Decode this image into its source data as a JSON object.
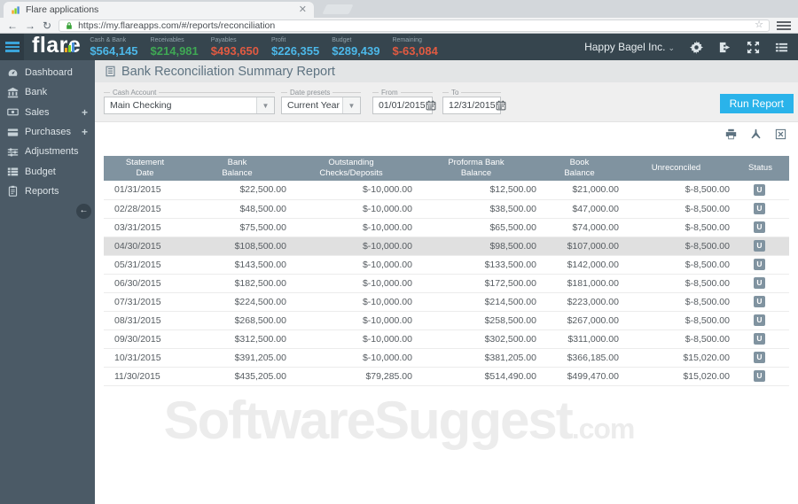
{
  "browser": {
    "tab_title": "Flare applications",
    "url": "https://my.flareapps.com/#/reports/reconciliation"
  },
  "header": {
    "logo_text": "flare",
    "company": "Happy Bagel Inc.",
    "company_caret": "⌄",
    "stats": [
      {
        "label": "Cash & Bank",
        "value": "$564,145",
        "color": "#4cb8e9"
      },
      {
        "label": "Receivables",
        "value": "$214,981",
        "color": "#3fa854"
      },
      {
        "label": "Payables",
        "value": "$493,650",
        "color": "#e25a41"
      },
      {
        "label": "Profit",
        "value": "$226,355",
        "color": "#4cb8e9"
      },
      {
        "label": "Budget",
        "value": "$289,439",
        "color": "#4cb8e9"
      },
      {
        "label": "Remaining",
        "value": "$-63,084",
        "color": "#e25a41"
      }
    ]
  },
  "sidebar": {
    "expand_glyph": "+",
    "items": [
      {
        "label": "Dashboard",
        "icon": "dashboard-icon",
        "expandable": false
      },
      {
        "label": "Bank",
        "icon": "bank-icon",
        "expandable": false
      },
      {
        "label": "Sales",
        "icon": "sales-icon",
        "expandable": true
      },
      {
        "label": "Purchases",
        "icon": "purchases-icon",
        "expandable": true
      },
      {
        "label": "Adjustments",
        "icon": "adjustments-icon",
        "expandable": false
      },
      {
        "label": "Budget",
        "icon": "budget-icon",
        "expandable": false
      },
      {
        "label": "Reports",
        "icon": "reports-icon",
        "expandable": false
      }
    ]
  },
  "report": {
    "title": "Bank Reconciliation Summary Report",
    "filters": {
      "cash_account": {
        "label": "Cash Account",
        "value": "Main Checking"
      },
      "date_presets": {
        "label": "Date presets",
        "value": "Current Year"
      },
      "from": {
        "label": "From",
        "value": "01/01/2015"
      },
      "to": {
        "label": "To",
        "value": "12/31/2015"
      },
      "run_button": "Run Report"
    },
    "table": {
      "columns": [
        [
          "Statement",
          "Date"
        ],
        [
          "Bank",
          "Balance"
        ],
        [
          "Outstanding",
          "Checks/Deposits"
        ],
        [
          "Proforma Bank",
          "Balance"
        ],
        [
          "Book",
          "Balance"
        ],
        [
          "Unreconciled"
        ],
        [
          "Status"
        ]
      ],
      "rows": [
        {
          "date": "01/31/2015",
          "bank_balance": "$22,500.00",
          "outstanding": "$-10,000.00",
          "proforma": "$12,500.00",
          "book": "$21,000.00",
          "unreconciled": "$-8,500.00",
          "status": "U",
          "highlighted": false
        },
        {
          "date": "02/28/2015",
          "bank_balance": "$48,500.00",
          "outstanding": "$-10,000.00",
          "proforma": "$38,500.00",
          "book": "$47,000.00",
          "unreconciled": "$-8,500.00",
          "status": "U",
          "highlighted": false
        },
        {
          "date": "03/31/2015",
          "bank_balance": "$75,500.00",
          "outstanding": "$-10,000.00",
          "proforma": "$65,500.00",
          "book": "$74,000.00",
          "unreconciled": "$-8,500.00",
          "status": "U",
          "highlighted": false
        },
        {
          "date": "04/30/2015",
          "bank_balance": "$108,500.00",
          "outstanding": "$-10,000.00",
          "proforma": "$98,500.00",
          "book": "$107,000.00",
          "unreconciled": "$-8,500.00",
          "status": "U",
          "highlighted": true
        },
        {
          "date": "05/31/2015",
          "bank_balance": "$143,500.00",
          "outstanding": "$-10,000.00",
          "proforma": "$133,500.00",
          "book": "$142,000.00",
          "unreconciled": "$-8,500.00",
          "status": "U",
          "highlighted": false
        },
        {
          "date": "06/30/2015",
          "bank_balance": "$182,500.00",
          "outstanding": "$-10,000.00",
          "proforma": "$172,500.00",
          "book": "$181,000.00",
          "unreconciled": "$-8,500.00",
          "status": "U",
          "highlighted": false
        },
        {
          "date": "07/31/2015",
          "bank_balance": "$224,500.00",
          "outstanding": "$-10,000.00",
          "proforma": "$214,500.00",
          "book": "$223,000.00",
          "unreconciled": "$-8,500.00",
          "status": "U",
          "highlighted": false
        },
        {
          "date": "08/31/2015",
          "bank_balance": "$268,500.00",
          "outstanding": "$-10,000.00",
          "proforma": "$258,500.00",
          "book": "$267,000.00",
          "unreconciled": "$-8,500.00",
          "status": "U",
          "highlighted": false
        },
        {
          "date": "09/30/2015",
          "bank_balance": "$312,500.00",
          "outstanding": "$-10,000.00",
          "proforma": "$302,500.00",
          "book": "$311,000.00",
          "unreconciled": "$-8,500.00",
          "status": "U",
          "highlighted": false
        },
        {
          "date": "10/31/2015",
          "bank_balance": "$391,205.00",
          "outstanding": "$-10,000.00",
          "proforma": "$381,205.00",
          "book": "$366,185.00",
          "unreconciled": "$15,020.00",
          "status": "U",
          "highlighted": false
        },
        {
          "date": "11/30/2015",
          "bank_balance": "$435,205.00",
          "outstanding": "$79,285.00",
          "proforma": "$514,490.00",
          "book": "$499,470.00",
          "unreconciled": "$15,020.00",
          "status": "U",
          "highlighted": false
        }
      ]
    }
  },
  "watermark": {
    "text": "SoftwareSuggest",
    "suffix": ".com"
  }
}
